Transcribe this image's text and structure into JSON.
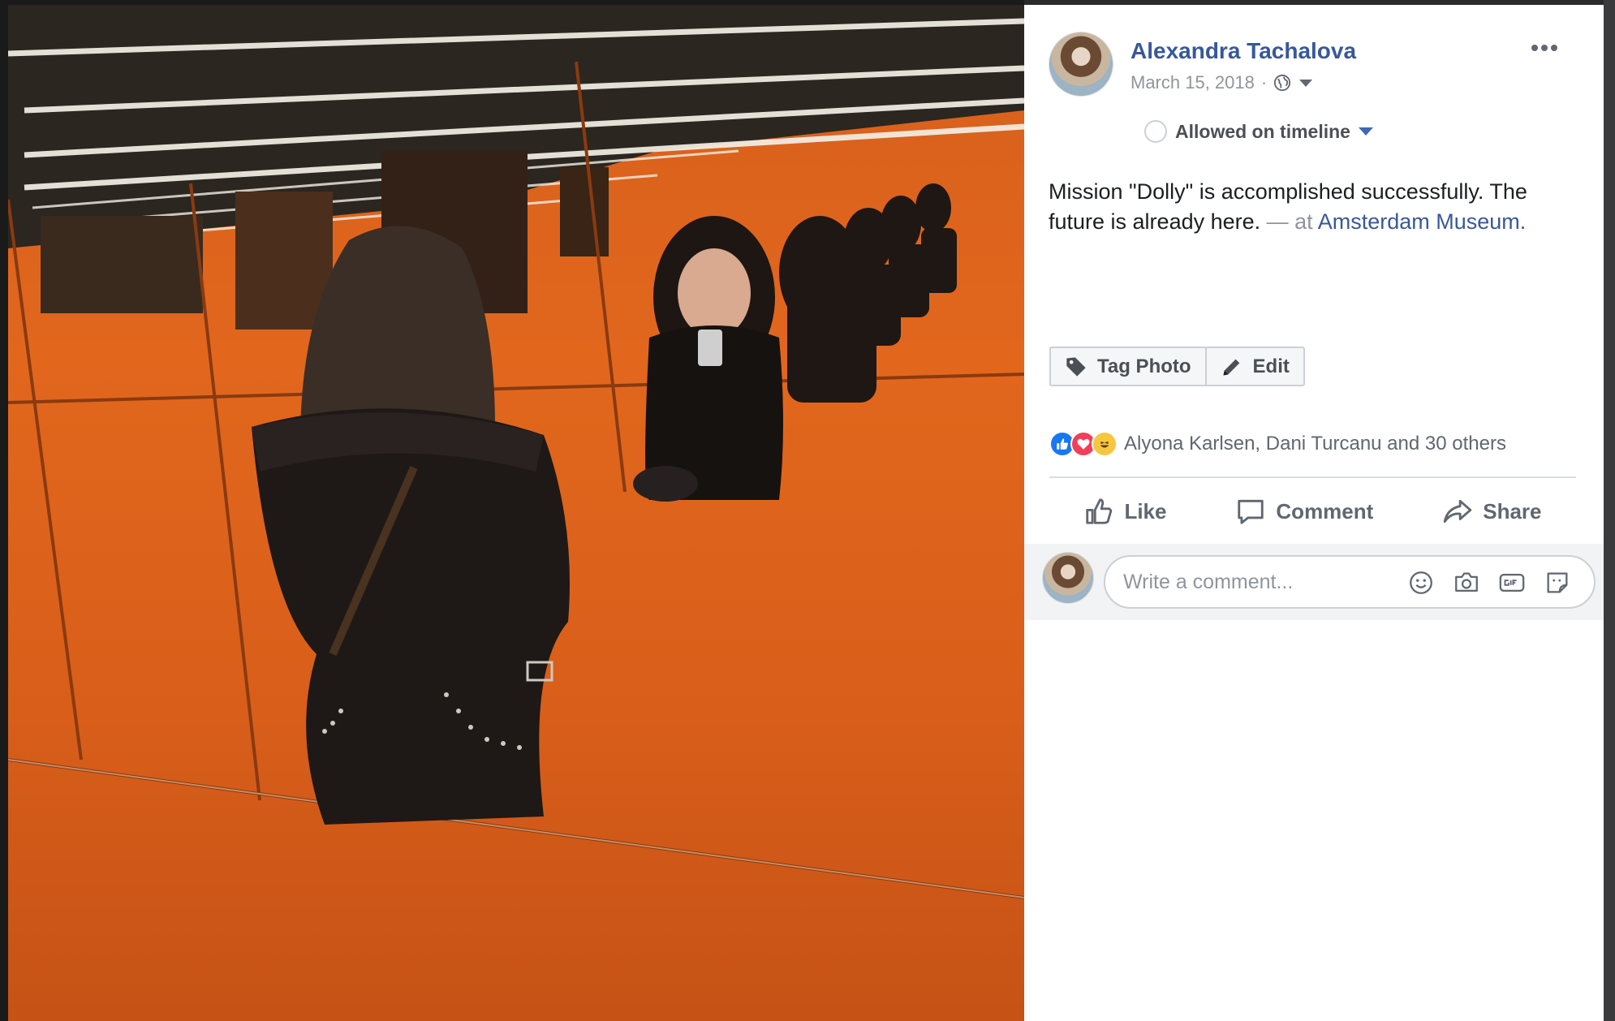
{
  "post": {
    "author": "Alexandra Tachalova",
    "date": "March 15, 2018",
    "date_separator": "·",
    "audience_icon": "globe-icon",
    "timeline_status": "Allowed on timeline",
    "message_text": "Mission \"Dolly\" is accomplished successfully. The future is already here.",
    "message_at": "— at",
    "location": "Amsterdam Museum."
  },
  "photo_actions": {
    "tag_label": "Tag Photo",
    "edit_label": "Edit"
  },
  "reactions": {
    "types": [
      "like",
      "love",
      "haha"
    ],
    "summary": "Alyona Karlsen, Dani Turcanu and 30 others"
  },
  "actions": {
    "like_label": "Like",
    "comment_label": "Comment",
    "share_label": "Share"
  },
  "comment": {
    "placeholder": "Write a comment...",
    "icons": [
      "emoji-icon",
      "camera-icon",
      "gif-icon",
      "sticker-icon"
    ]
  },
  "colors": {
    "link": "#385898",
    "accent": "#4267b2",
    "photo_wall": "#e2671d"
  }
}
